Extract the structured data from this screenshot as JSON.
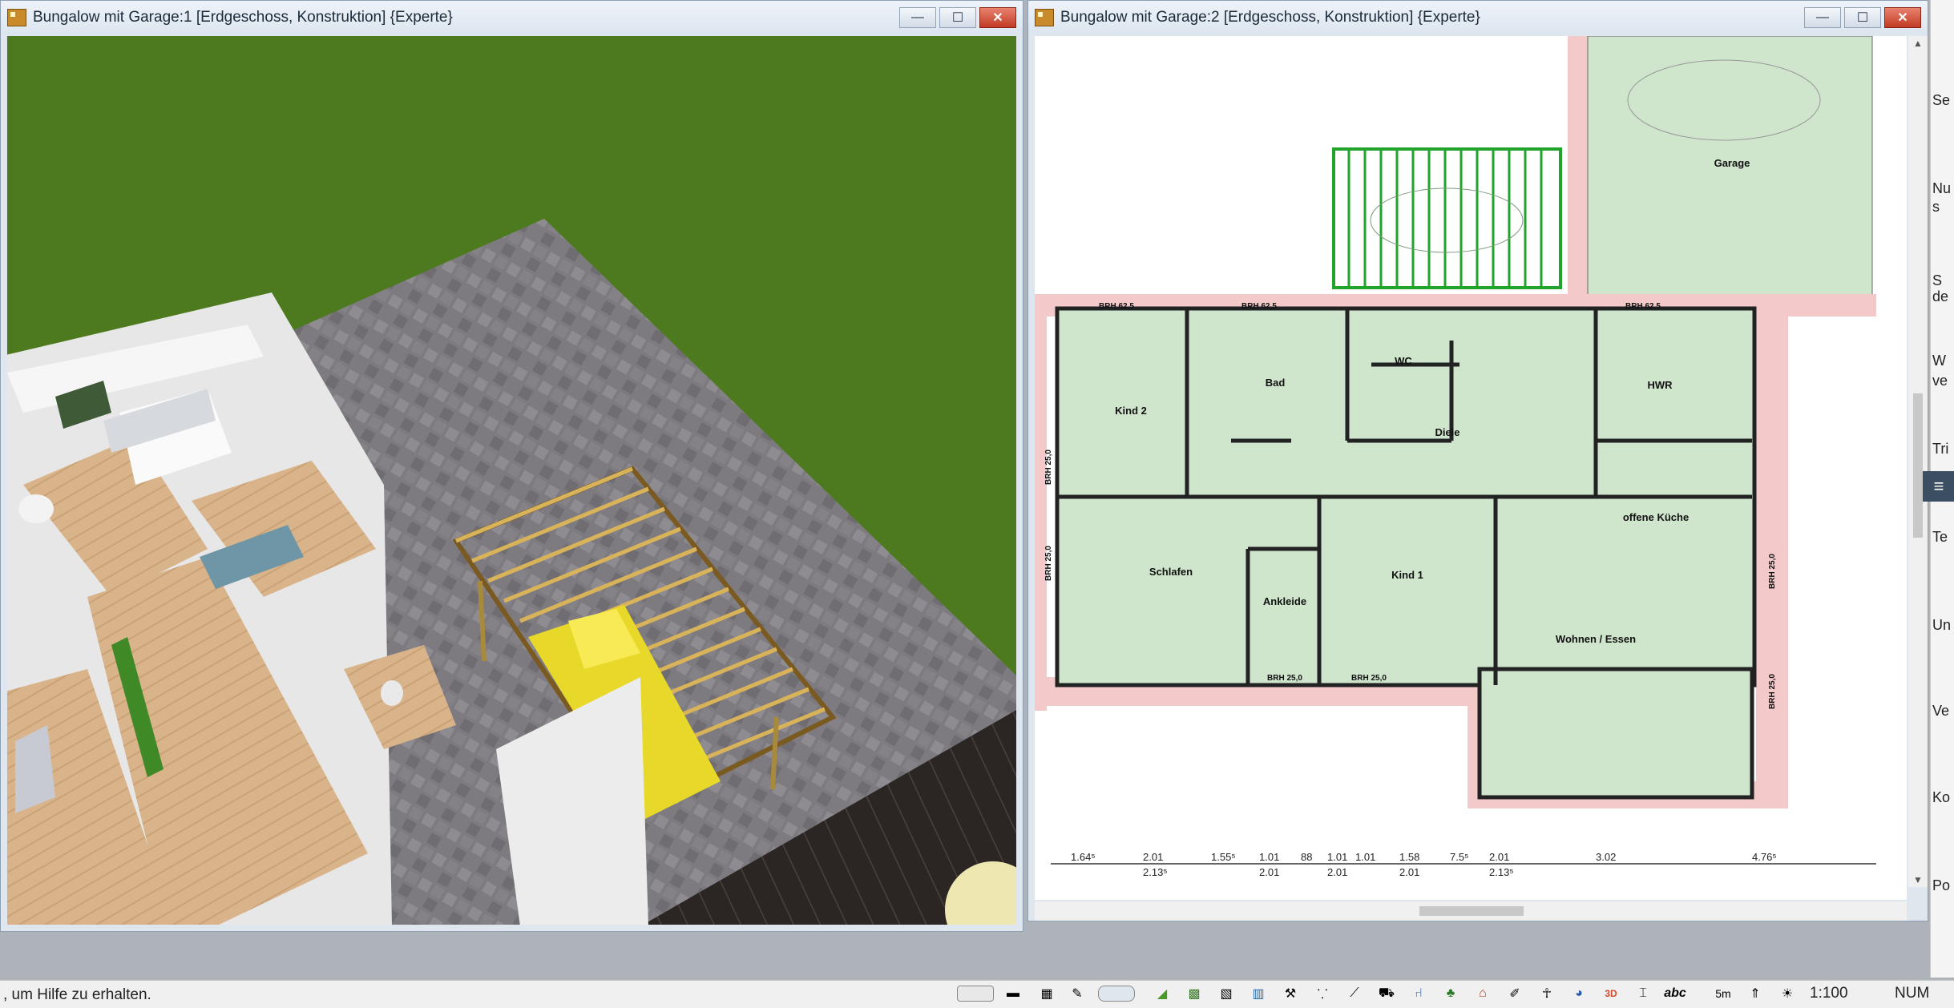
{
  "window_left": {
    "title": "Bungalow mit Garage:1 [Erdgeschoss, Konstruktion] {Experte}"
  },
  "window_right": {
    "title": "Bungalow mit Garage:2 [Erdgeschoss, Konstruktion] {Experte}"
  },
  "window_controls": {
    "minimize": "—",
    "maximize": "☐",
    "close": "✕"
  },
  "plan": {
    "rooms": [
      "Garage",
      "WC",
      "Bad",
      "Kind 2",
      "HWR",
      "Diele",
      "offene Küche",
      "Schlafen",
      "Ankleide",
      "Kind 1",
      "Wohnen / Essen"
    ],
    "window_labels": [
      "BRH 62,5",
      "BRH 62,5",
      "BRH 62,5",
      "BRH 25,0",
      "BRH 25,0",
      "BRH 25,0",
      "BRH 25,0",
      "BRH 25,0",
      "BRH 25,0"
    ],
    "dimensions_top": [
      "1.64⁵",
      "2.01",
      "1.55⁵",
      "1.01",
      "88",
      "1.01",
      "1.01",
      "1.58",
      "7.5⁵",
      "2.01",
      "3.02",
      "4.76⁵"
    ],
    "dimensions_bottom": [
      "2.13⁵",
      "2.01",
      "2.01",
      "2.01",
      "2.13⁵"
    ]
  },
  "right_panel": {
    "texts": [
      "Se",
      "Nu",
      "s",
      "S",
      "de",
      "W",
      "ve",
      "Tri",
      "Te",
      "Un",
      "Ve",
      "Ko",
      "Po"
    ]
  },
  "status": {
    "help_text": ", um Hilfe zu erhalten.",
    "num": "NUM",
    "scale": "1:100",
    "toolbar_text_abc": "abc",
    "toolbar_text_5m": "5m",
    "toolbar_text_3d": "3D"
  },
  "colors": {
    "grass": "#4d7a1f",
    "room_fill": "#cfe6cc",
    "wall_hatch": "#f3c9c9",
    "pergola": "#22a32c"
  }
}
